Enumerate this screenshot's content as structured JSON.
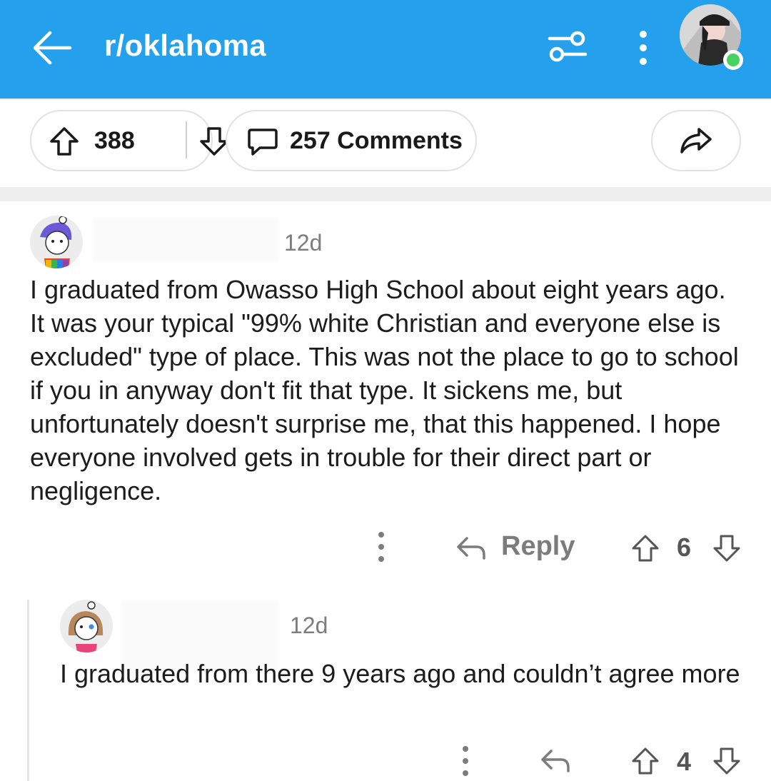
{
  "header": {
    "title": "r/oklahoma",
    "icons": [
      "back-arrow-icon",
      "filter-icon",
      "more-vertical-icon",
      "user-avatar"
    ],
    "colors": {
      "bar": "#24a0ed",
      "online": "#46d160"
    }
  },
  "post_actions": {
    "score": "388",
    "comments_label": "257 Comments",
    "icons": [
      "upvote-icon",
      "downvote-icon",
      "comment-icon",
      "share-icon"
    ]
  },
  "comments": [
    {
      "age": "12d",
      "body": "I graduated from Owasso High School about eight years ago. It was your typical \"99% white Christian and everyone else is excluded\" type of place. This was not the place to go to school if you in anyway don't fit that type. It sickens me, but unfortunately doesn't surprise me, that this happened. I hope everyone involved gets in trouble for their direct part or negligence.",
      "reply_label": "Reply",
      "score": "6"
    },
    {
      "age": "12d",
      "body": "I graduated from there 9 years ago and couldn’t agree more",
      "score": "4"
    }
  ]
}
